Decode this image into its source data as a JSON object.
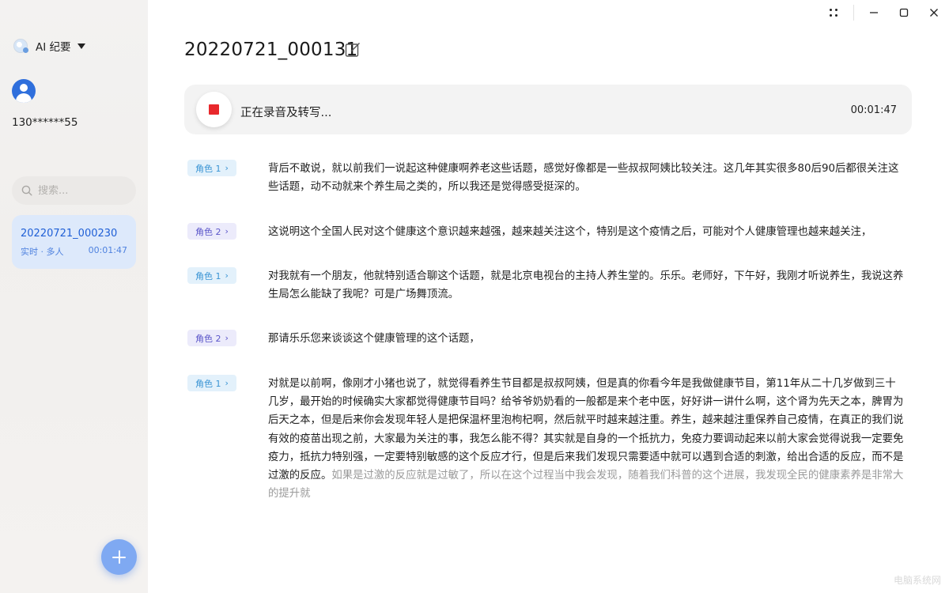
{
  "sidebar": {
    "app_name": "AI 纪要",
    "phone": "130******55",
    "search_placeholder": "搜索...",
    "recording": {
      "title": "20220721_000230",
      "meta": "实时 · 多人",
      "duration": "00:01:47"
    }
  },
  "main": {
    "title": "20220721_000131",
    "status_text": "正在录音及转写...",
    "elapsed": "00:01:47"
  },
  "segments": [
    {
      "speaker": "角色 1",
      "text": "背后不敢说，就以前我们一说起这种健康啊养老这些话题，感觉好像都是一些叔叔阿姨比较关注。这几年其实很多80后90后都很关注这些话题，动不动就来个养生局之类的，所以我还是觉得感受挺深的。"
    },
    {
      "speaker": "角色 2",
      "text": "这说明这个全国人民对这个健康这个意识越来越强，越来越关注这个，特别是这个疫情之后，可能对个人健康管理也越来越关注，"
    },
    {
      "speaker": "角色 1",
      "text": "对我就有一个朋友，他就特别适合聊这个话题，就是北京电视台的主持人养生堂的。乐乐。老师好，下午好，我刚才听说养生，我说这养生局怎么能缺了我呢？可是广场舞顶流。"
    },
    {
      "speaker": "角色 2",
      "text": "那请乐乐您来谈谈这个健康管理的这个话题，"
    },
    {
      "speaker": "角色 1",
      "text": "对就是以前啊，像刚才小猪也说了，就觉得看养生节目都是叔叔阿姨，但是真的你看今年是我做健康节目，第11年从二十几岁做到三十几岁，最开始的时候确实大家都觉得健康节目吗？给爷爷奶奶看的一般都是来个老中医，好好讲一讲什么啊，这个肾为先天之本，脾胃为后天之本，但是后来你会发现年轻人是把保温杯里泡枸杞啊，然后就平时越来越注重。养生，越来越注重保养自己疫情，在真正的我们说有效的疫苗出现之前，大家最为关注的事，我怎么能不得？其实就是自身的一个抵抗力，免疫力要调动起来以前大家会觉得说我一定要免疫力，抵抗力特别强，一定要特别敏感的这个反应才行，但是后来我们发现只需要适中就可以遇到合适的刺激，给出合适的反应，而不是过激的反应。",
      "text_faded": "如果是过激的反应就是过敏了，所以在这个过程当中我会发现，随着我们科普的这个进展，我发现全民的健康素养是非常大的提升就"
    }
  ],
  "watermark": "电脑系统网"
}
